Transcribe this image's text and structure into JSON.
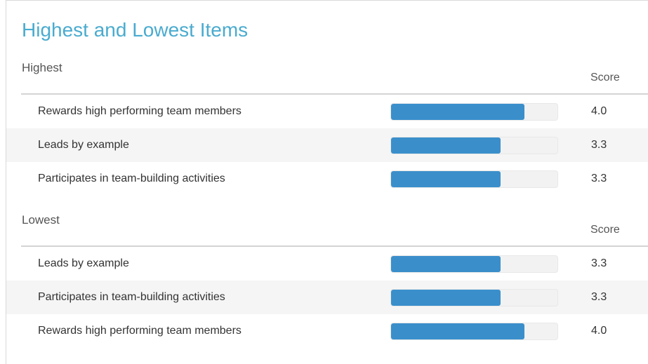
{
  "title": "Highest and Lowest Items",
  "colors": {
    "title": "#4aabcf",
    "bar_fill": "#3a8fcb",
    "bar_track": "#f2f2f2",
    "alt_row": "#f5f5f5"
  },
  "score_max": 5,
  "sections": [
    {
      "label": "Highest",
      "score_header": "Score",
      "rows": [
        {
          "label": "Rewards high performing team members",
          "score": "4.0",
          "value": 4.0
        },
        {
          "label": "Leads by example",
          "score": "3.3",
          "value": 3.3
        },
        {
          "label": "Participates in team-building activities",
          "score": "3.3",
          "value": 3.3
        }
      ]
    },
    {
      "label": "Lowest",
      "score_header": "Score",
      "rows": [
        {
          "label": "Leads by example",
          "score": "3.3",
          "value": 3.3
        },
        {
          "label": "Participates in team-building activities",
          "score": "3.3",
          "value": 3.3
        },
        {
          "label": "Rewards high performing team members",
          "score": "4.0",
          "value": 4.0
        }
      ]
    }
  ]
}
